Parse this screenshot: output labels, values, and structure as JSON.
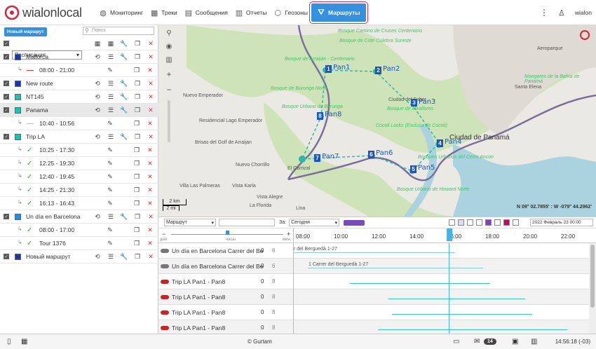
{
  "app": {
    "logo": "wialonlocal",
    "user": "wialon"
  },
  "nav": [
    {
      "label": "Мониторинг",
      "icon": "globe-icon"
    },
    {
      "label": "Треки",
      "icon": "tracks-icon"
    },
    {
      "label": "Сообщения",
      "icon": "messages-icon"
    },
    {
      "label": "Отчеты",
      "icon": "reports-icon"
    },
    {
      "label": "Геозоны",
      "icon": "geofences-icon"
    },
    {
      "label": "Маршруты",
      "icon": "routes-icon",
      "active": true
    }
  ],
  "left": {
    "new_button": "Новый маршрут",
    "search_placeholder": "Поиск",
    "filter_value": "Расписания",
    "routes": [
      {
        "name": "Mallorca",
        "color": "#1e35a6",
        "schedules": [
          {
            "time": "08:00 - 21:00",
            "mark": "dash-red"
          }
        ]
      },
      {
        "name": "New route",
        "color": "#1e35a6",
        "schedules": []
      },
      {
        "name": "NT145",
        "color": "#1fbfb0",
        "schedules": []
      },
      {
        "name": "Panama",
        "color": "#1fbfb0",
        "schedules": [
          {
            "time": "10:40 - 10:56",
            "mark": "dash-grey"
          }
        ]
      },
      {
        "name": "Trip LA",
        "color": "#1fbfb0",
        "schedules": [
          {
            "time": "10:25 - 17:30",
            "mark": "check"
          },
          {
            "time": "12:25 - 19:30",
            "mark": "check"
          },
          {
            "time": "12:40 - 19:45",
            "mark": "check"
          },
          {
            "time": "14:25 - 21:30",
            "mark": "check"
          },
          {
            "time": "16:13 - 16:43",
            "mark": "check"
          }
        ]
      },
      {
        "name": "Un día en Barcelona",
        "color": "#2a8ad6",
        "schedules": [
          {
            "time": "08:00 - 17:00",
            "mark": "check"
          },
          {
            "time": "Tour 1376",
            "mark": "check"
          }
        ]
      },
      {
        "name": "Новый маршрут",
        "color": "#1e35a6",
        "schedules": []
      }
    ]
  },
  "map": {
    "points": [
      {
        "n": "1",
        "label": "Pan1"
      },
      {
        "n": "2",
        "label": "Pan2"
      },
      {
        "n": "3",
        "label": "Pan3"
      },
      {
        "n": "4",
        "label": "Pan4"
      },
      {
        "n": "5",
        "label": "Pan5"
      },
      {
        "n": "6",
        "label": "Pan6"
      },
      {
        "n": "7",
        "label": "Pan7"
      },
      {
        "n": "8",
        "label": "Pan8"
      }
    ],
    "labels": [
      "Bosque Camino de Cruces Centenario",
      "Bosque de Arraiján",
      "Bosque de Cote Culebra Sureste",
      "Bosque de Arraiján - Centenario",
      "Bosque de Burunga Norte",
      "Nuevo Emperador",
      "Bosque Urbano de Burunga",
      "Residencial Lago Emperador",
      "Brisas del Golf de Arraijan",
      "Nuevo Chorrillo",
      "El Carrizal",
      "Villa Las Palmeras",
      "Vista Karla",
      "Vista Alegre",
      "La Florida",
      "La Florencia",
      "Palma",
      "Lina",
      "Bosque Urbano de Howard Norte",
      "Ciudad de Panamá",
      "Santa Elena",
      "Cocoli Locks (Esclusa de Cocoli)",
      "Bosques Urbanos del Cerro Ancon",
      "Bosque de Miraflores",
      "Ciudad del Saber",
      "Aeroparque",
      "Mangares de la Bahía de Panamá"
    ],
    "scale": "2 km",
    "scale2": "2 mi",
    "coords": "N 09° 02.7855' : W -079° 44.2962'"
  },
  "timeline": {
    "type_value": "Маршрут",
    "for_label": "За:",
    "period_value": "Сегодня",
    "date_value": "2022 Февраль 23 00:00",
    "hours": [
      "08:00",
      "10:00",
      "12:00",
      "14:00",
      "16:00",
      "18:00",
      "20:00",
      "22:00"
    ],
    "scale_labels": [
      "дни",
      "часы",
      "мин."
    ],
    "rows": [
      {
        "name": "Un día en Barcelona Carrer del Berguedà",
        "a": "0",
        "b": "6",
        "text": "r del Berguedà 1-27"
      },
      {
        "name": "Un día en Barcelona Carrer del Berguedà",
        "a": "0",
        "b": "6",
        "text": "1 Carrer del Berguedà 1-27"
      },
      {
        "name": "Trip LA Pan1 - Pan8",
        "a": "0",
        "b": "8",
        "text": ""
      },
      {
        "name": "Trip LA Pan1 - Pan8",
        "a": "0",
        "b": "8",
        "text": ""
      },
      {
        "name": "Trip LA Pan1 - Pan8",
        "a": "0",
        "b": "8",
        "text": ""
      },
      {
        "name": "Trip LA Pan1 - Pan8",
        "a": "0",
        "b": "8",
        "text": ""
      }
    ]
  },
  "footer": {
    "copyright": "© Gurtam",
    "badge": "14",
    "time": "14:56:18 (-03)"
  }
}
